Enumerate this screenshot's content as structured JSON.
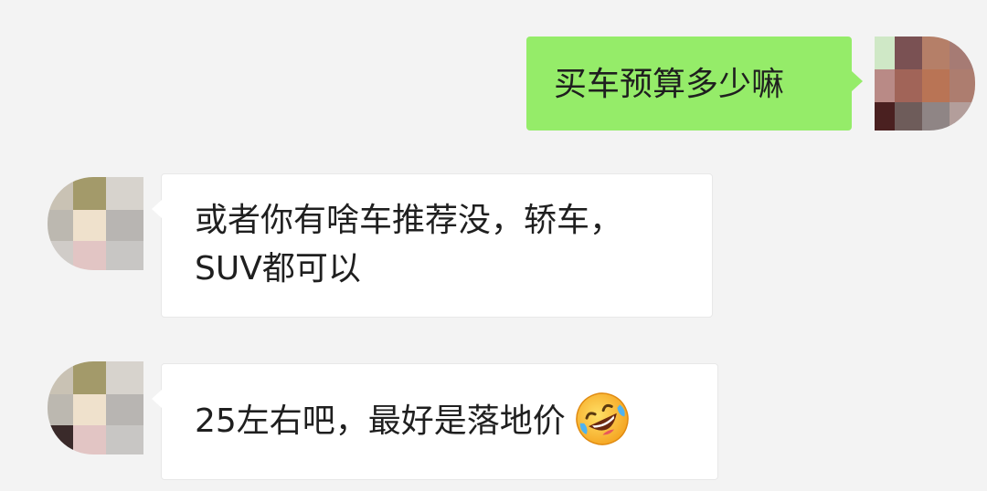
{
  "messages": [
    {
      "side": "right",
      "text": "买车预算多少嘛"
    },
    {
      "side": "left",
      "text": "或者你有啥车推荐没，轿车，\nSUV都可以"
    },
    {
      "side": "left",
      "text": "25左右吧，最好是落地价",
      "emoji": "rolling-on-floor-laughing-emoji"
    }
  ],
  "colors": {
    "background": "#f3f3f3",
    "sent_bubble": "#95ec69",
    "received_bubble": "#ffffff",
    "text": "#1f1f1f"
  }
}
